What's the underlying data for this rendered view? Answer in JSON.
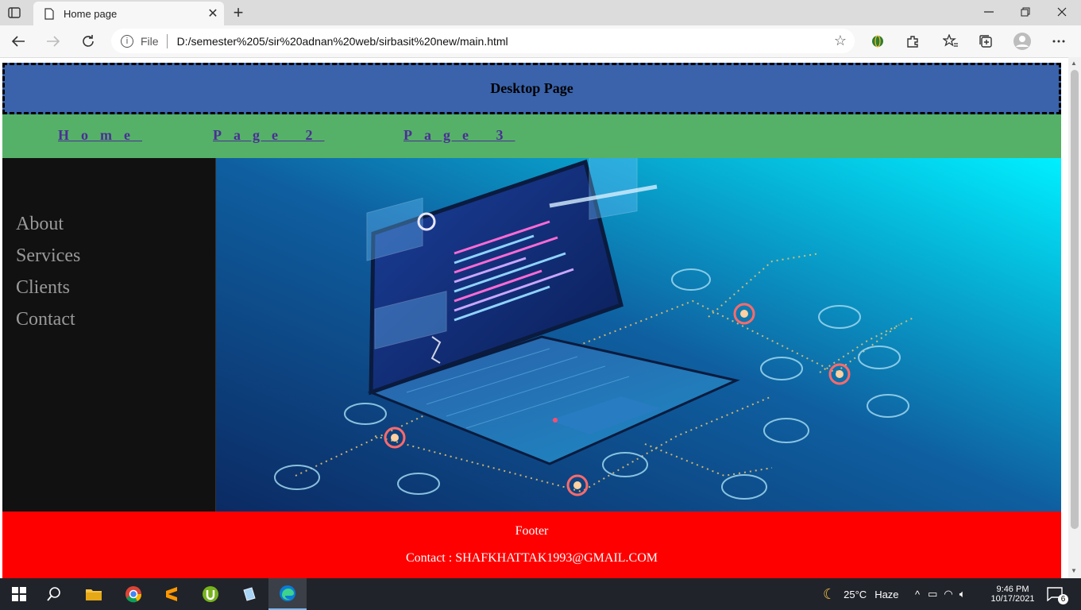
{
  "browser": {
    "tab_title": "Home page",
    "tab_close": "✕",
    "new_tab": "+",
    "address_scheme_label": "File",
    "address_url": "D:/semester%205/sir%20adnan%20web/sirbasit%20new/main.html"
  },
  "page": {
    "header_title": "Desktop Page",
    "nav": [
      {
        "label": "Home"
      },
      {
        "label": "Page 2"
      },
      {
        "label": "Page 3"
      }
    ],
    "sidebar": [
      {
        "label": "About"
      },
      {
        "label": "Services"
      },
      {
        "label": "Clients"
      },
      {
        "label": "Contact"
      }
    ],
    "footer": {
      "title": "Footer",
      "contact": "Contact : SHAFKHATTAK1993@GMAIL.COM"
    }
  },
  "taskbar": {
    "weather_temp": "25°C",
    "weather_desc": "Haze",
    "time": "9:46 PM",
    "date": "10/17/2021",
    "notification_count": "6"
  },
  "colors": {
    "header_bg": "#3a63ab",
    "nav_bg": "#55b168",
    "nav_link": "#4b2e96",
    "sidebar_bg": "#111111",
    "footer_bg": "#ff0000"
  }
}
